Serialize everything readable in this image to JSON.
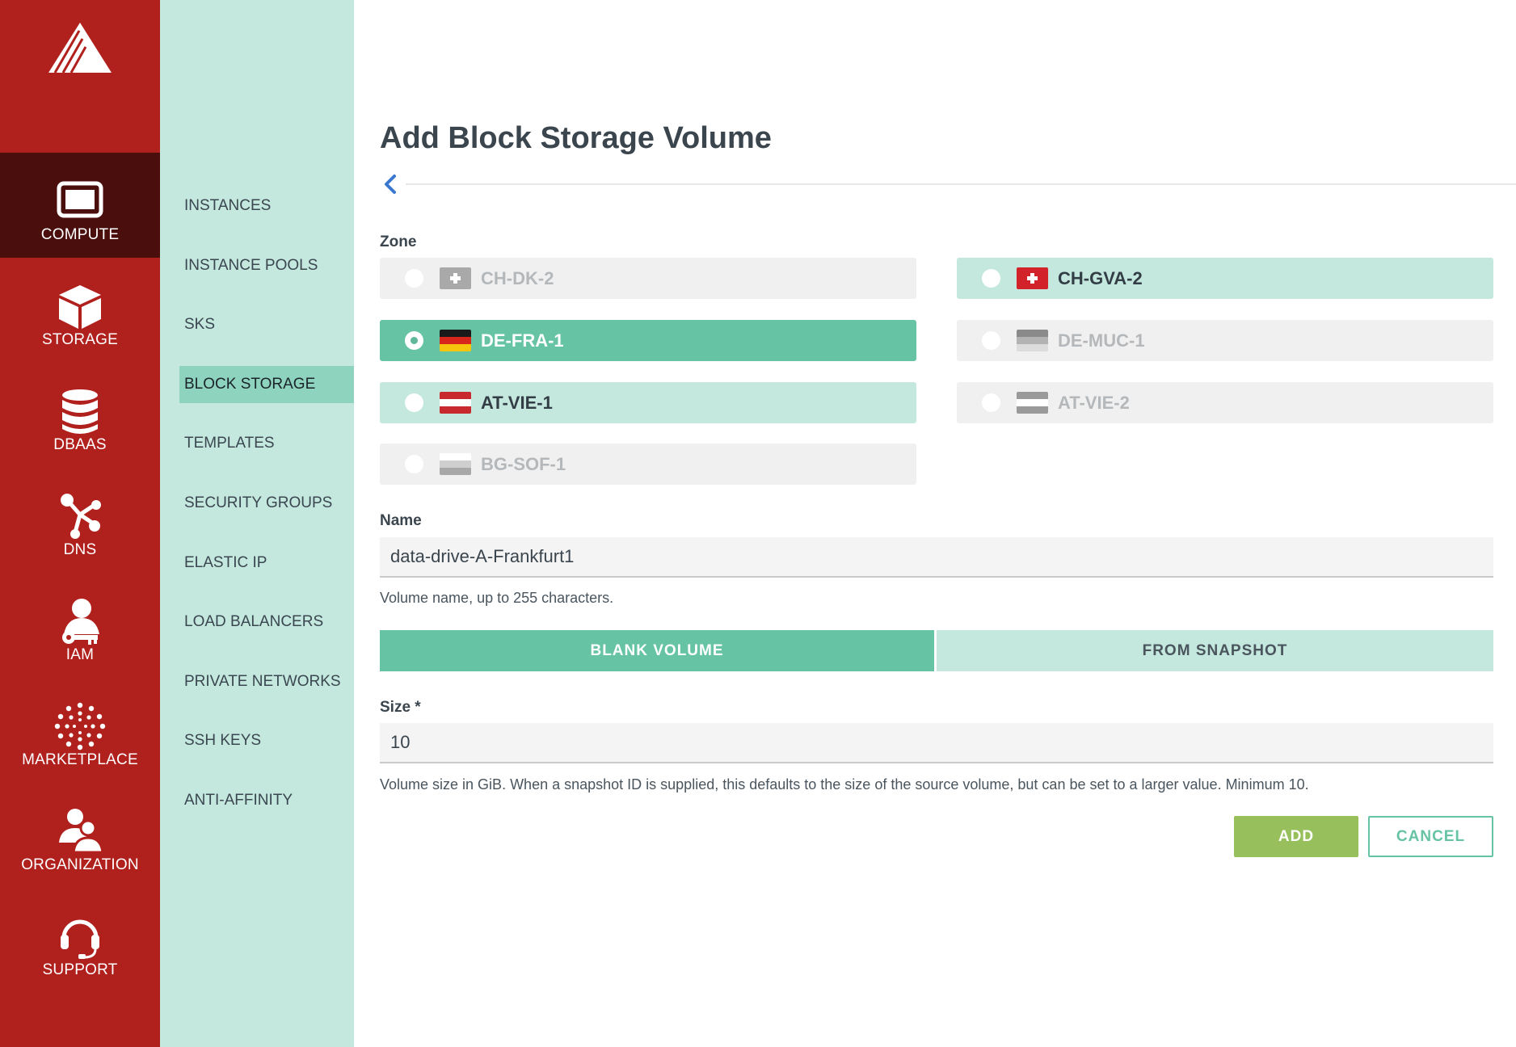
{
  "rail": {
    "items": [
      {
        "label": "COMPUTE",
        "icon": "monitor-icon"
      },
      {
        "label": "STORAGE",
        "icon": "cube-icon"
      },
      {
        "label": "DBAAS",
        "icon": "database-icon"
      },
      {
        "label": "DNS",
        "icon": "share-nodes-icon"
      },
      {
        "label": "IAM",
        "icon": "user-key-icon"
      },
      {
        "label": "MARKETPLACE",
        "icon": "dots-burst-icon"
      },
      {
        "label": "ORGANIZATION",
        "icon": "users-icon"
      },
      {
        "label": "SUPPORT",
        "icon": "headset-icon"
      }
    ]
  },
  "subnav": {
    "items": [
      {
        "label": "INSTANCES"
      },
      {
        "label": "INSTANCE POOLS"
      },
      {
        "label": "SKS"
      },
      {
        "label": "BLOCK STORAGE"
      },
      {
        "label": "TEMPLATES"
      },
      {
        "label": "SECURITY GROUPS"
      },
      {
        "label": "ELASTIC IP"
      },
      {
        "label": "LOAD BALANCERS"
      },
      {
        "label": "PRIVATE NETWORKS"
      },
      {
        "label": "SSH KEYS"
      },
      {
        "label": "ANTI-AFFINITY"
      }
    ],
    "active": "BLOCK STORAGE"
  },
  "page": {
    "title": "Add Block Storage Volume"
  },
  "zone": {
    "label": "Zone",
    "options": [
      {
        "name": "CH-DK-2",
        "state": "disabled",
        "flag": "ch-grey"
      },
      {
        "name": "CH-GVA-2",
        "state": "available",
        "flag": "ch"
      },
      {
        "name": "DE-FRA-1",
        "state": "selected",
        "flag": "de"
      },
      {
        "name": "DE-MUC-1",
        "state": "disabled",
        "flag": "de-grey"
      },
      {
        "name": "AT-VIE-1",
        "state": "available",
        "flag": "at"
      },
      {
        "name": "AT-VIE-2",
        "state": "disabled",
        "flag": "at-grey"
      },
      {
        "name": "BG-SOF-1",
        "state": "disabled",
        "flag": "bg-grey"
      }
    ]
  },
  "name_field": {
    "label": "Name",
    "value": "data-drive-A-Frankfurt1",
    "help": "Volume name, up to 255 characters."
  },
  "source_tabs": {
    "blank": "BLANK VOLUME",
    "snapshot": "FROM SNAPSHOT",
    "active": "BLANK VOLUME"
  },
  "size_field": {
    "label": "Size *",
    "value": "10",
    "help": "Volume size in GiB. When a snapshot ID is supplied, this defaults to the size of the source volume, but can be set to a larger value. Minimum 10."
  },
  "actions": {
    "add": "ADD",
    "cancel": "CANCEL"
  },
  "colors": {
    "rail": "#b0201d",
    "rail_active": "#4a0e0c",
    "subnav": "#c4e8de",
    "accent": "#66c4a5",
    "add_button": "#97c05c"
  }
}
